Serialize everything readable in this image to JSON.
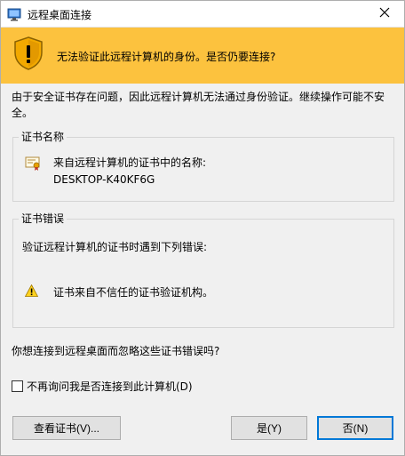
{
  "window": {
    "title": "远程桌面连接"
  },
  "banner": {
    "message": "无法验证此远程计算机的身份。是否仍要连接?",
    "color": "#fcc23e"
  },
  "intro": {
    "text": "由于安全证书存在问题，因此远程计算机无法通过身份验证。继续操作可能不安全。"
  },
  "cert_name_group": {
    "label": "证书名称",
    "caption": "来自远程计算机的证书中的名称:",
    "value": "DESKTOP-K40KF6G"
  },
  "cert_error_group": {
    "label": "证书错误",
    "intro": "验证远程计算机的证书时遇到下列错误:",
    "errors": [
      "证书来自不信任的证书验证机构。"
    ]
  },
  "question": "你想连接到远程桌面而忽略这些证书错误吗?",
  "checkbox": {
    "label": "不再询问我是否连接到此计算机(D)",
    "checked": false
  },
  "buttons": {
    "view_cert": "查看证书(V)...",
    "yes": "是(Y)",
    "no": "否(N)"
  },
  "icons": {
    "app": "remote-desktop-icon",
    "close": "close-icon",
    "shield": "shield-warning-icon",
    "certificate": "certificate-icon",
    "warning": "warning-icon"
  },
  "colors": {
    "accent_focus": "#0078d7",
    "warning_yellow": "#fcc23e"
  }
}
